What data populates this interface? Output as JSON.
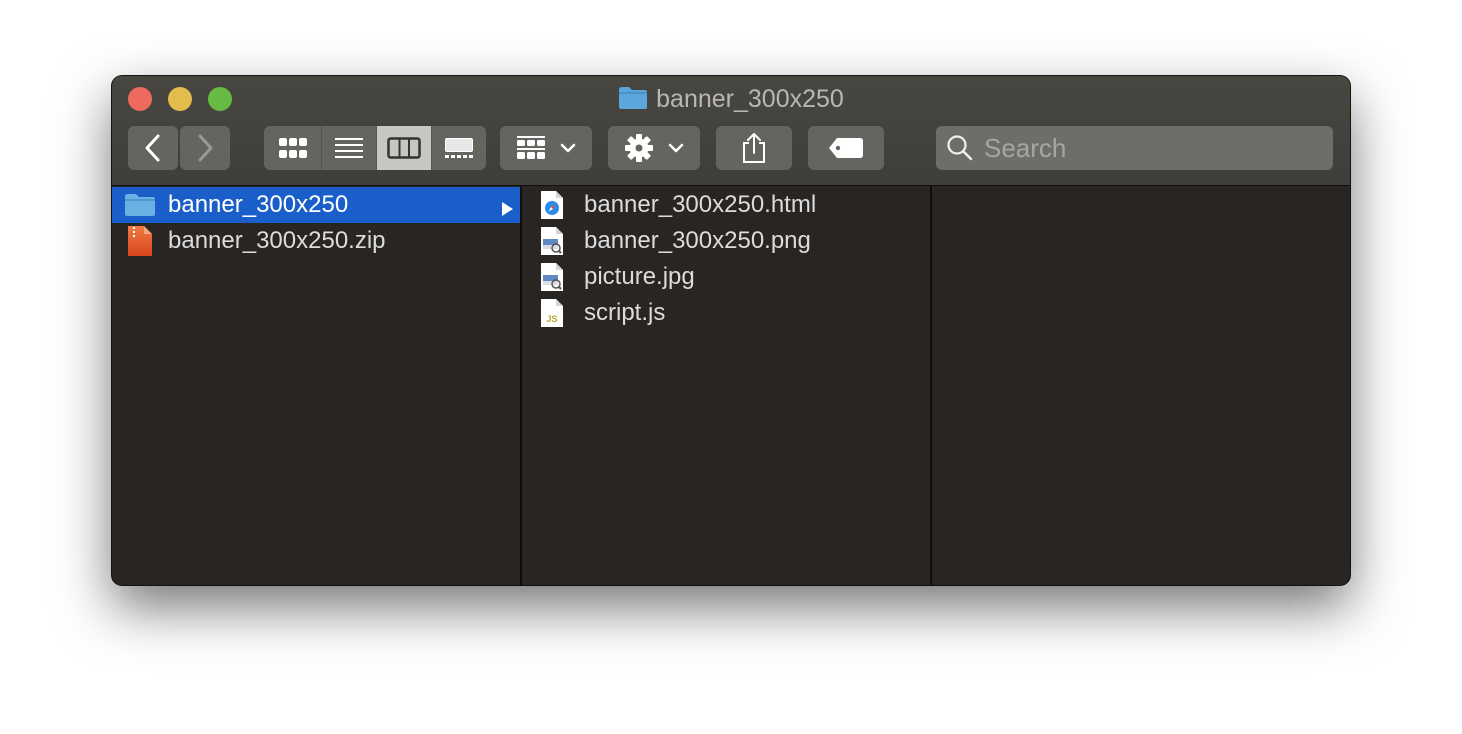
{
  "window": {
    "title": "banner_300x250",
    "title_icon": "folder-icon"
  },
  "toolbar": {
    "back_icon": "chevron-left-icon",
    "forward_icon": "chevron-right-icon",
    "view_modes": [
      {
        "name": "icon-view",
        "icon": "grid-icon",
        "active": false
      },
      {
        "name": "list-view",
        "icon": "list-icon",
        "active": false
      },
      {
        "name": "column-view",
        "icon": "columns-icon",
        "active": true
      },
      {
        "name": "gallery-view",
        "icon": "gallery-icon",
        "active": false
      }
    ],
    "group_icon": "group-icon",
    "action_icon": "gear-icon",
    "share_icon": "share-icon",
    "tag_icon": "tag-icon",
    "search_placeholder": "Search"
  },
  "columns": [
    {
      "items": [
        {
          "name": "banner_300x250",
          "icon": "folder-icon",
          "selected": true,
          "has_children": true
        },
        {
          "name": "banner_300x250.zip",
          "icon": "zip-file-icon",
          "selected": false
        }
      ]
    },
    {
      "items": [
        {
          "name": "banner_300x250.html",
          "icon": "html-file-icon"
        },
        {
          "name": "banner_300x250.png",
          "icon": "image-file-icon"
        },
        {
          "name": "picture.jpg",
          "icon": "image-file-icon"
        },
        {
          "name": "script.js",
          "icon": "js-file-icon"
        }
      ]
    },
    {
      "items": []
    }
  ],
  "colors": {
    "selection": "#1a5fc9",
    "close": "#ee6a5f",
    "minimize": "#e2bd4d",
    "maximize": "#67bb45",
    "folder": "#5aa6dd"
  }
}
